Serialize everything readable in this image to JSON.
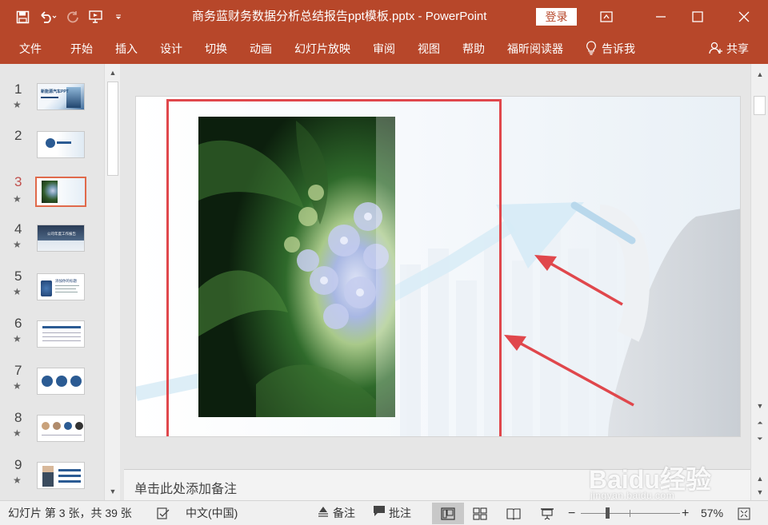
{
  "window": {
    "title": "商务蓝财务数据分析总结报告ppt模板.pptx  -  PowerPoint",
    "login_label": "登录"
  },
  "ribbon": {
    "tabs": [
      "文件",
      "开始",
      "插入",
      "设计",
      "切换",
      "动画",
      "幻灯片放映",
      "审阅",
      "视图",
      "帮助",
      "福昕阅读器"
    ],
    "tell_me": "告诉我",
    "share": "共享"
  },
  "thumbnails": {
    "selected": "3",
    "items": [
      {
        "number": "1",
        "star": "★",
        "caption": "新能源汽车PPT"
      },
      {
        "number": "2",
        "star": ""
      },
      {
        "number": "3",
        "star": "★"
      },
      {
        "number": "4",
        "star": "★",
        "caption": "公司年度工作报告"
      },
      {
        "number": "5",
        "star": "★",
        "caption": "添加你的标题"
      },
      {
        "number": "6",
        "star": "★"
      },
      {
        "number": "7",
        "star": "★"
      },
      {
        "number": "8",
        "star": "★"
      },
      {
        "number": "9",
        "star": "★"
      }
    ]
  },
  "notes": {
    "placeholder": "单击此处添加备注"
  },
  "status": {
    "slide_info": "幻灯片 第 3 张，共 39 张",
    "language": "中文(中国)",
    "notes_label": "备注",
    "comments_label": "批注",
    "zoom_percent": "57%",
    "zoom_level": 0.57
  },
  "watermark": {
    "brand": "Baidu经验",
    "url": "jingyan.baidu.com"
  },
  "colors": {
    "accent": "#b7472a",
    "highlight": "#e0474c",
    "thumb_selected": "#e0694a"
  }
}
